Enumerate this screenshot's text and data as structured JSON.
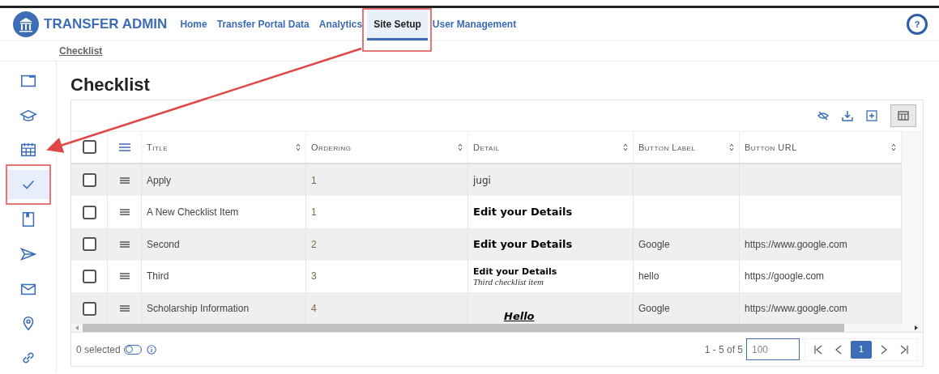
{
  "header": {
    "brand": "TRANSFER ADMIN",
    "nav": [
      {
        "label": "Home",
        "selected": false
      },
      {
        "label": "Transfer Portal Data",
        "selected": false
      },
      {
        "label": "Analytics",
        "selected": false
      },
      {
        "label": "Site Setup",
        "selected": true
      },
      {
        "label": "User Management",
        "selected": false
      }
    ],
    "help": "?"
  },
  "breadcrumb": "Checklist",
  "sidebar": {
    "items": [
      {
        "selected": false
      },
      {
        "selected": false
      },
      {
        "selected": false
      },
      {
        "selected": true
      },
      {
        "selected": false
      },
      {
        "selected": false
      },
      {
        "selected": false
      },
      {
        "selected": false
      },
      {
        "selected": false
      }
    ]
  },
  "page_title": "Checklist",
  "table": {
    "select_all_checked": false,
    "columns": [
      "Title",
      "Ordering",
      "Detail",
      "Button Label",
      "Button URL"
    ],
    "rows": [
      {
        "checked": false,
        "title": "Apply",
        "ordering": "1",
        "detail": [
          {
            "kind": "plain",
            "text": "jugi"
          }
        ]
      },
      {
        "checked": false,
        "title": "A New Checklist Item",
        "ordering": "1",
        "detail": [
          {
            "kind": "heading",
            "text": "Edit your Details"
          }
        ]
      },
      {
        "checked": false,
        "title": "Second",
        "ordering": "2",
        "detail": [
          {
            "kind": "heading",
            "text": "Edit your Details"
          }
        ],
        "button_label": "Google",
        "button_url": "https://www.google.com"
      },
      {
        "checked": false,
        "title": "Third",
        "ordering": "3",
        "detail": [
          {
            "kind": "strong",
            "text": "Edit your Details"
          },
          {
            "kind": "italic",
            "text": "Third checklist item"
          }
        ],
        "button_label": "hello",
        "button_url": "https://google.com"
      },
      {
        "checked": false,
        "title": "Scholarship Information",
        "ordering": "4",
        "detail": [
          {
            "kind": "emphasis",
            "text": "Hello"
          }
        ],
        "button_label": "Google",
        "button_url": "https://www.google.com"
      }
    ],
    "footer": {
      "selected_count": "0 selected",
      "toggle_on": false,
      "range": "1 - 5 of 5",
      "page_size": "100",
      "pages": [
        {
          "label": "1",
          "selected": true
        }
      ]
    }
  }
}
